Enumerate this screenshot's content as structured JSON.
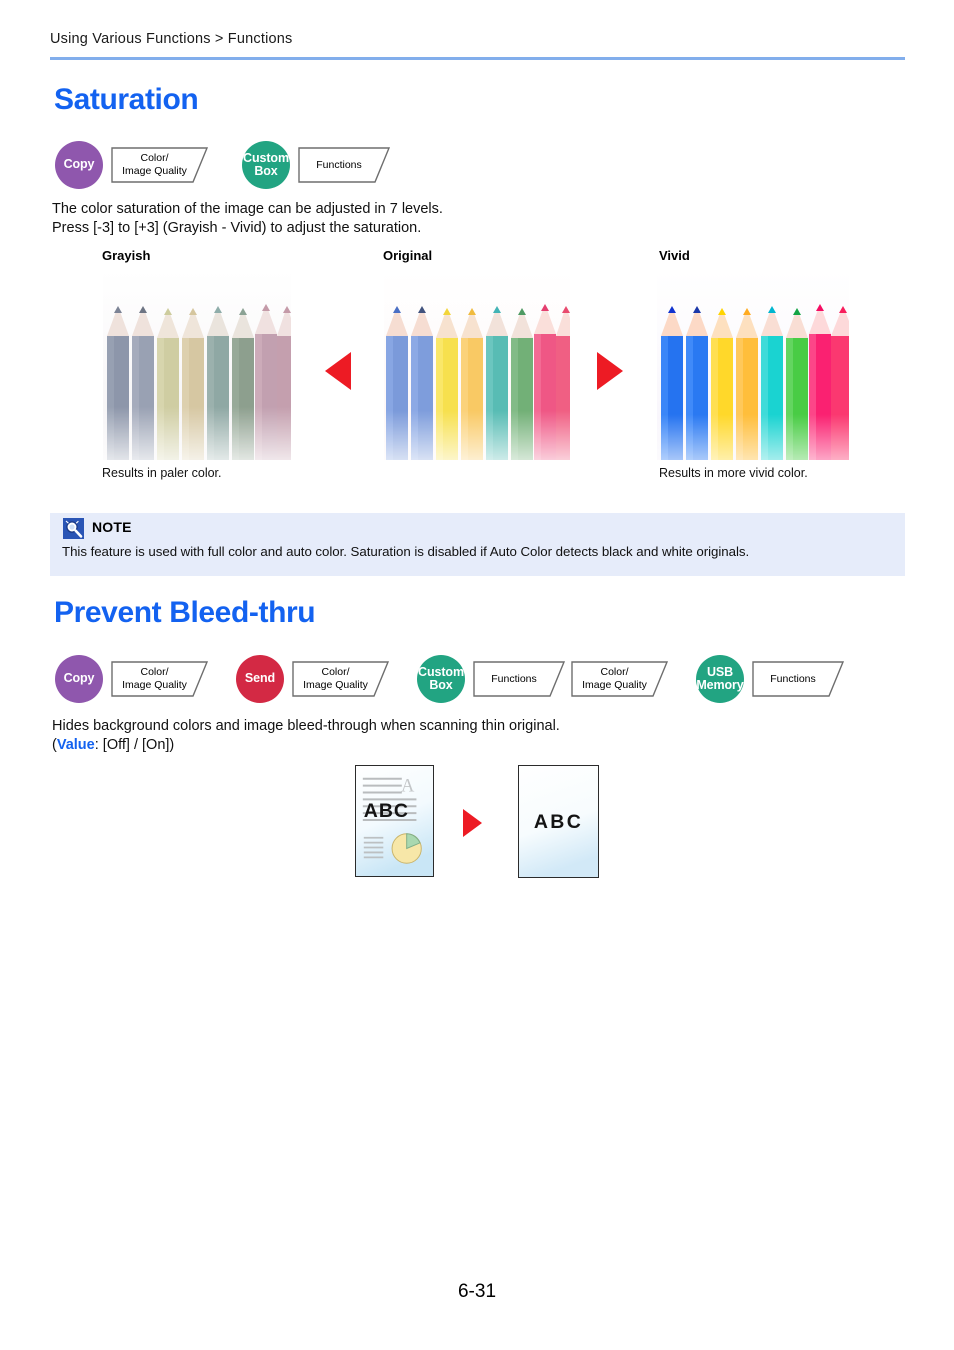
{
  "header": {
    "breadcrumb": "Using Various Functions > Functions"
  },
  "colors": {
    "heading_blue": "#1362f0",
    "rule_blue": "#82aeec",
    "copy_purple": "#8f57ad",
    "send_red": "#d32944",
    "box_green": "#22a482",
    "usb_green": "#22a482",
    "arrow_red": "#ed1b24",
    "note_bg": "#e6ecfa",
    "note_icon_blue": "#2a55b5"
  },
  "sections": [
    {
      "id": "saturation",
      "title": "Saturation",
      "badges": [
        {
          "circle": "Copy",
          "circle_color": "purple",
          "chip": "Color/\nImage Quality"
        },
        {
          "circle": "Custom Box",
          "circle_color": "green",
          "chip": "Functions"
        }
      ],
      "paragraph_line1": "The color saturation of the image can be adjusted in 7 levels.",
      "paragraph_line2": "Press [-3] to [+3] (Grayish - Vivid) to adjust the saturation.",
      "samples": [
        {
          "label": "Grayish",
          "caption": "Results in paler color."
        },
        {
          "label": "Original",
          "caption": ""
        },
        {
          "label": "Vivid",
          "caption": "Results in more vivid color."
        }
      ],
      "note": {
        "icon": "magnifier-note-icon",
        "title": "NOTE",
        "body": "This feature is used with full color and auto color. Saturation is disabled if Auto Color detects black and white originals."
      }
    },
    {
      "id": "prevent-bleed-thru",
      "title": "Prevent Bleed-thru",
      "badges": [
        {
          "circle": "Copy",
          "circle_color": "purple",
          "chip": "Color/\nImage Quality"
        },
        {
          "circle": "Send",
          "circle_color": "red",
          "chip": "Color/\nImage Quality"
        },
        {
          "circle": "Custom Box",
          "circle_color": "green",
          "chip": "Functions"
        },
        {
          "circle": "",
          "circle_color": "none",
          "chip": "Color/\nImage Quality"
        },
        {
          "circle": "USB Memory",
          "circle_color": "green",
          "chip": "Functions"
        }
      ],
      "paragraph_line1": "Hides background colors and image bleed-through when scanning thin original.",
      "value_prefix": "(",
      "value_label": "Value",
      "value_rest": ": [Off] / [On])",
      "illustration": {
        "before_text": "A B C",
        "before_ghost_letter": "A",
        "after_text": "A B C"
      }
    }
  ],
  "footer": {
    "page_number": "6-31"
  }
}
